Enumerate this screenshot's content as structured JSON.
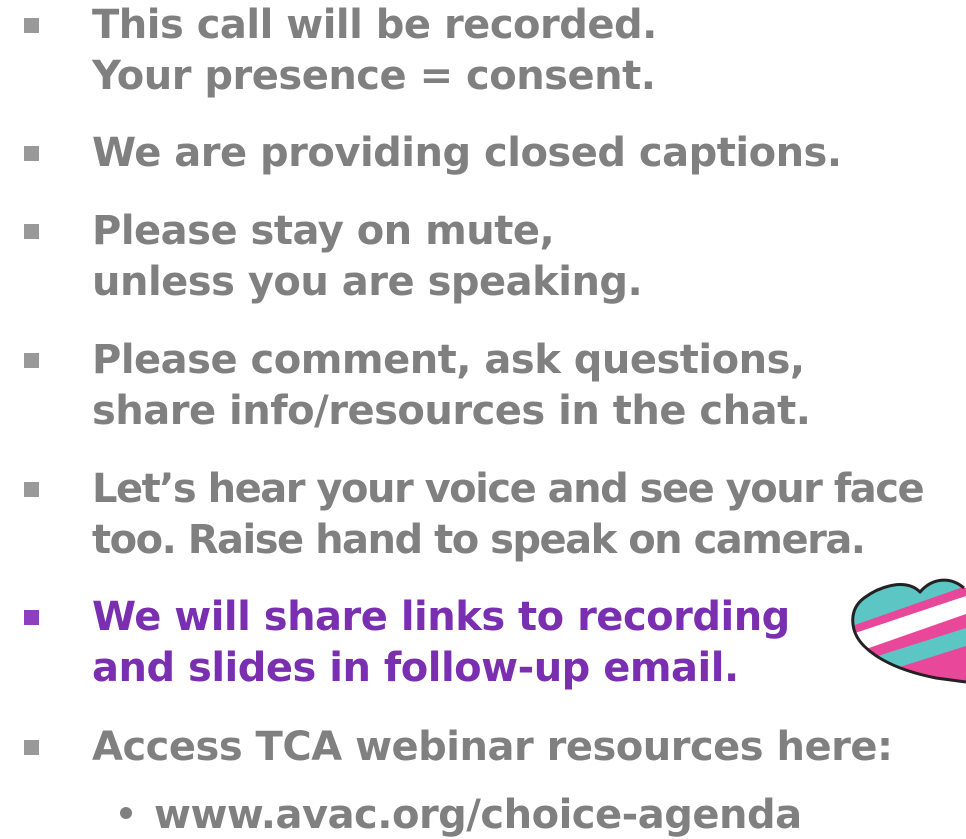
{
  "bullets": [
    {
      "lines": [
        "This call will be recorded.",
        "Your presence = consent."
      ]
    },
    {
      "lines": [
        "We are providing closed captions."
      ]
    },
    {
      "lines": [
        "Please stay on mute,",
        "unless you are speaking."
      ]
    },
    {
      "lines": [
        "Please comment, ask questions,",
        "share info/resources in the chat."
      ]
    },
    {
      "lines": [
        "Let’s hear your voice and see your face",
        "too. Raise hand to speak on camera."
      ]
    },
    {
      "lines": [
        "We will share links to recording",
        "and slides in follow-up email."
      ]
    },
    {
      "lines": [
        "Access TCA webinar resources here:"
      ]
    }
  ],
  "sub_bullet": "www.avac.org/choice-agenda",
  "colors": {
    "text": "#808080",
    "highlight": "#7a2fb0",
    "heart_pink": "#e8479a",
    "heart_teal": "#5cc6c4"
  },
  "icons": [
    "heart-sticker-icon"
  ]
}
